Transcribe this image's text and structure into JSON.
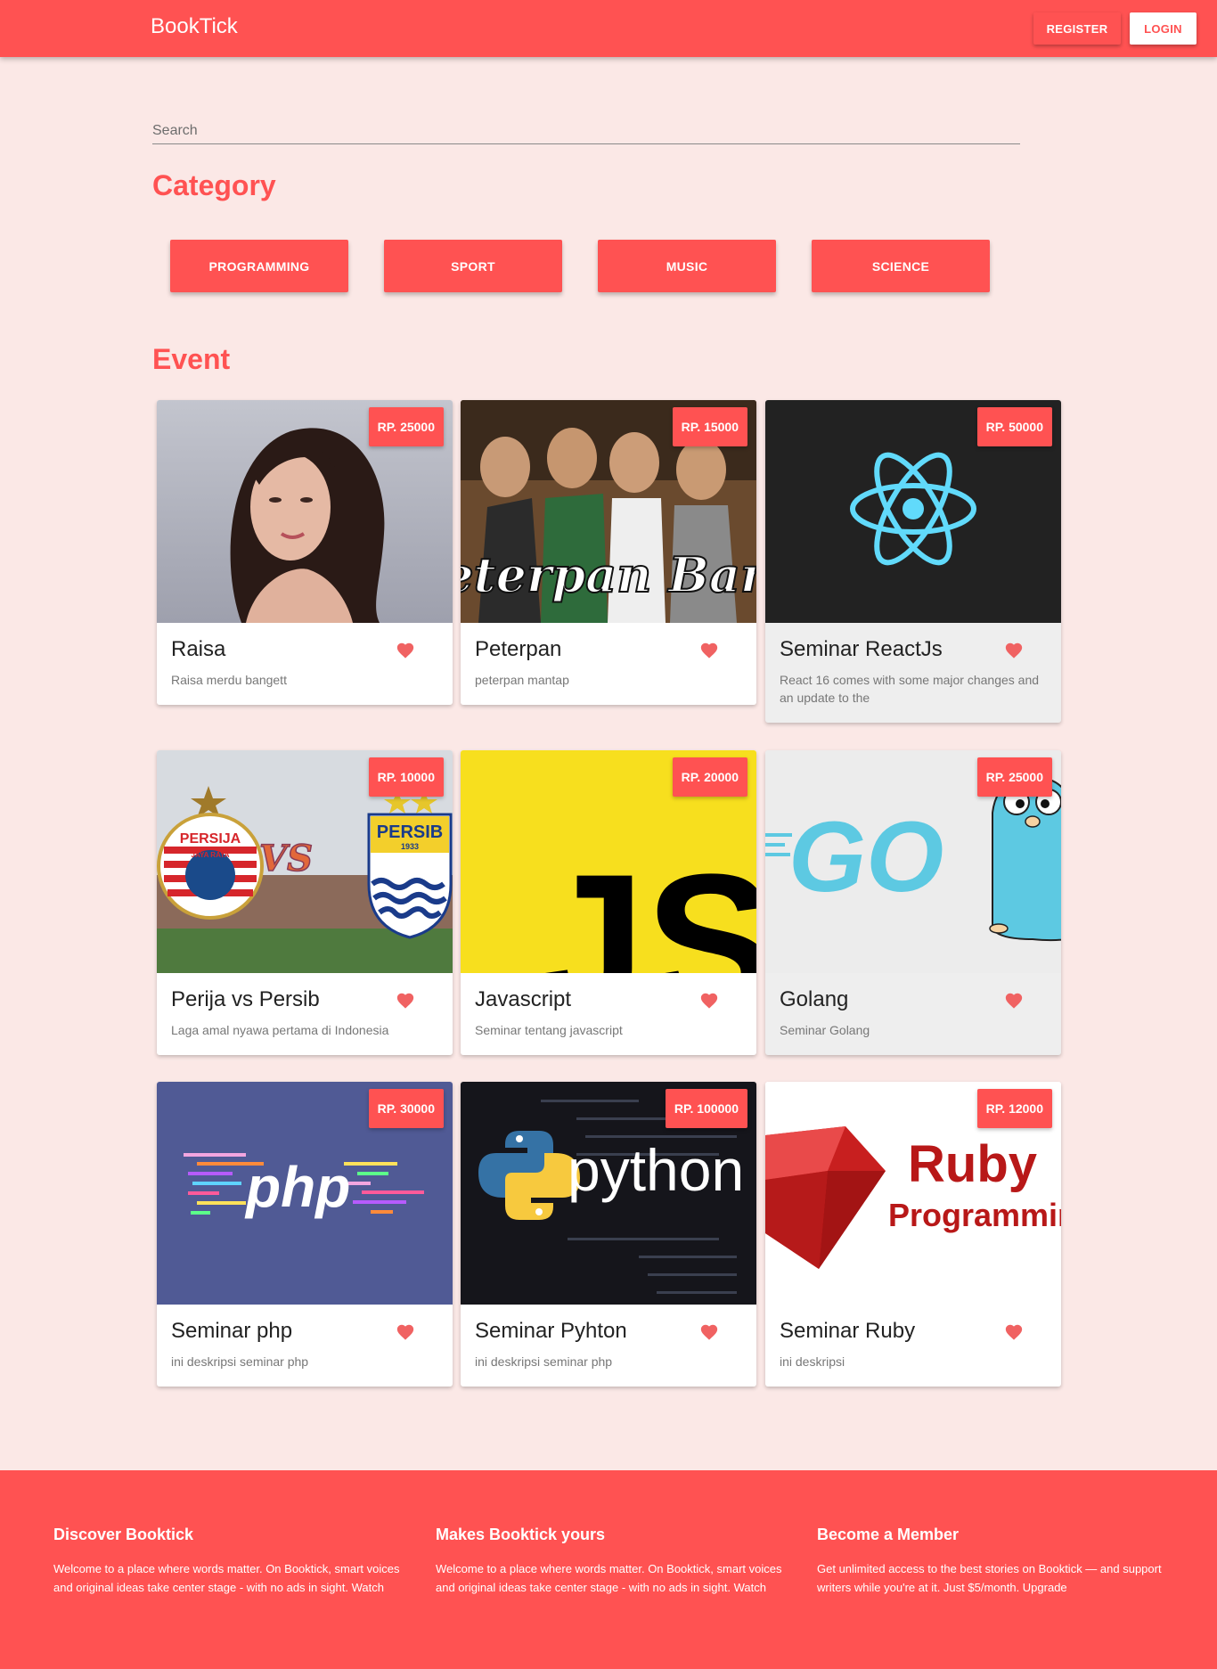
{
  "app": {
    "brand": "BookTick"
  },
  "header": {
    "register_label": "REGISTER",
    "login_label": "LOGIN"
  },
  "search": {
    "placeholder": "Search"
  },
  "category": {
    "title": "Category",
    "items": [
      "PROGRAMMING",
      "SPORT",
      "MUSIC",
      "SCIENCE"
    ]
  },
  "events": {
    "title": "Event",
    "items": [
      {
        "title": "Raisa",
        "description": "Raisa merdu bangett",
        "price": "RP. 25000"
      },
      {
        "title": "Peterpan",
        "description": "peterpan mantap",
        "price": "RP. 15000",
        "image_text": "Peterpan Band"
      },
      {
        "title": "Seminar ReactJs",
        "description": "React 16 comes with some major changes and an update to the",
        "price": "RP. 50000"
      },
      {
        "title": "Perija vs Persib",
        "description": "Laga amal nyawa pertama di Indonesia",
        "price": "RP. 10000",
        "image_text": {
          "left": "PERSIJA",
          "left_sub": "JAYA RAYA",
          "vs": "VS",
          "right": "PERSIB",
          "right_sub": "1933"
        }
      },
      {
        "title": "Javascript",
        "description": "Seminar tentang javascript",
        "price": "RP. 20000",
        "image_text": "JS"
      },
      {
        "title": "Golang",
        "description": "Seminar Golang",
        "price": "RP. 25000",
        "image_text": "GO"
      },
      {
        "title": "Seminar php",
        "description": "ini deskripsi seminar php",
        "price": "RP. 30000",
        "image_text": "php"
      },
      {
        "title": "Seminar Pyhton",
        "description": "ini deskripsi seminar php",
        "price": "RP. 100000",
        "image_text": "python"
      },
      {
        "title": "Seminar Ruby",
        "description": "ini deskripsi",
        "price": "RP. 12000",
        "image_text": {
          "line1": "Ruby",
          "line2": "Programming"
        }
      }
    ]
  },
  "footer": {
    "columns": [
      {
        "title": "Discover Booktick",
        "text": "Welcome to a place where words matter. On Booktick, smart voices and original ideas take center stage - with no ads in sight. Watch"
      },
      {
        "title": "Makes Booktick yours",
        "text": "Welcome to a place where words matter. On Booktick, smart voices and original ideas take center stage - with no ads in sight. Watch"
      },
      {
        "title": "Become a Member",
        "text": "Get unlimited access to the best stories on Booktick — and support writers while you're at it. Just $5/month. Upgrade"
      }
    ]
  },
  "colors": {
    "primary": "#ff5252",
    "background": "#fbe8e6",
    "heart": "#f06262"
  }
}
